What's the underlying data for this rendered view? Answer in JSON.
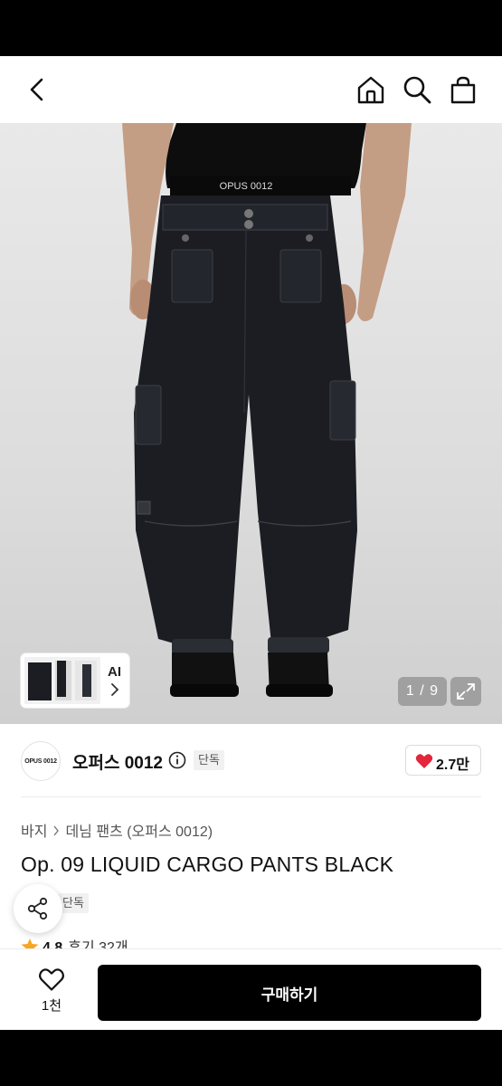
{
  "topbar": {
    "back_icon": "chevron-left-icon",
    "home_icon": "home-icon",
    "search_icon": "search-icon",
    "bag_icon": "shopping-bag-icon"
  },
  "gallery": {
    "waistband_text": "OPUS 0012",
    "ai_label": "AI",
    "counter": "1 / 9",
    "current_page": 1,
    "total_pages": 9
  },
  "brand": {
    "logo_text": "OPUS 0012",
    "name": "오퍼스 0012",
    "exclusive_tag": "단독",
    "likes": "2.7만"
  },
  "product": {
    "breadcrumb": [
      "바지",
      "데님 팬츠 (오퍼스 0012)"
    ],
    "title": "Op. 09 LIQUID CARGO PANTS BLACK",
    "tag": "단독",
    "rating_score": "4.8",
    "reviews": "후기 32개"
  },
  "bottom": {
    "wish_count": "1천",
    "buy_label": "구매하기"
  },
  "colors": {
    "like_heart": "#e3263a",
    "star": "#f5a623",
    "buy_button": "#000000"
  }
}
